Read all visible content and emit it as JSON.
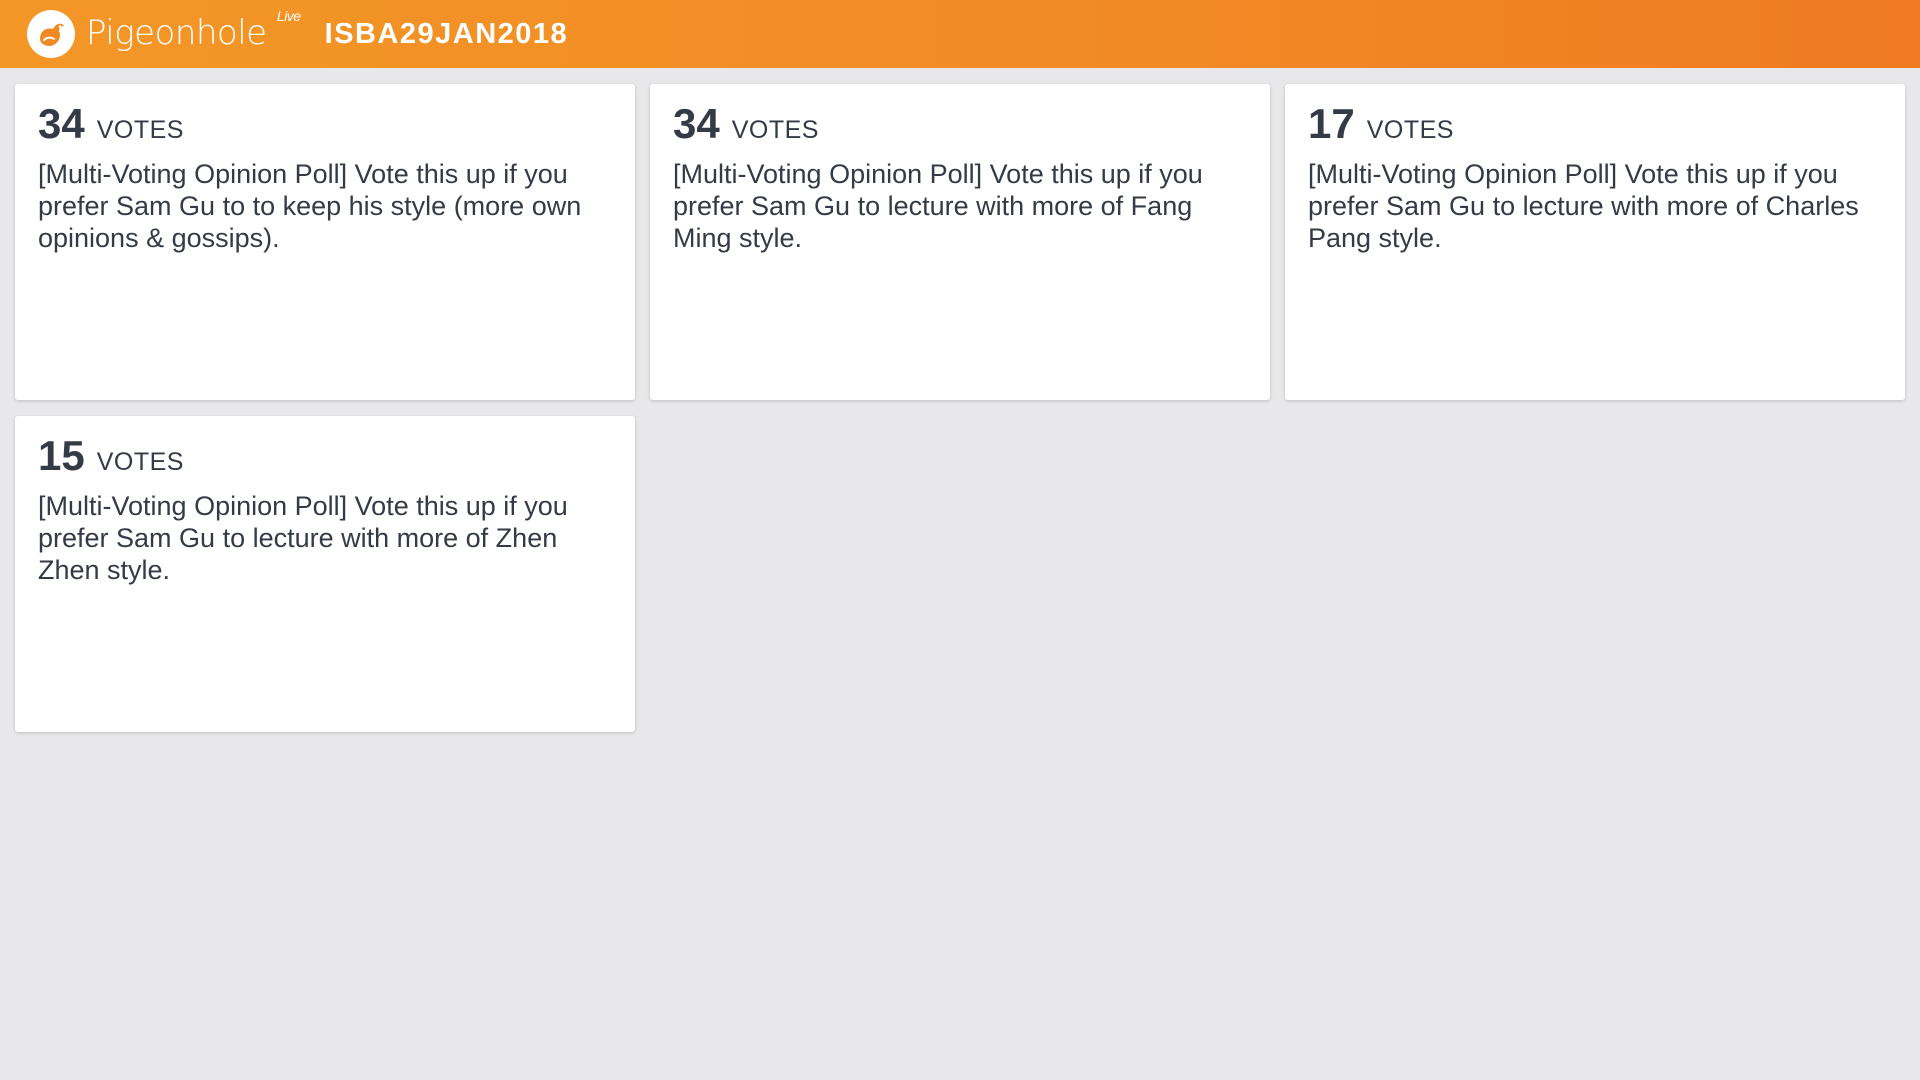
{
  "header": {
    "brand_name": "Pigeonhole",
    "brand_suffix": "Live",
    "session_code": "ISBA29JAN2018",
    "colors": {
      "gradient_start": "#f39727",
      "gradient_end": "#ef7a22"
    },
    "logo_icon": "pigeon-logo-icon"
  },
  "questions": [
    {
      "votes": "34",
      "votes_label": "VOTES",
      "text": "[Multi-Voting Opinion Poll] Vote this up if you prefer Sam Gu to to keep his style (more own opinions & gossips)."
    },
    {
      "votes": "34",
      "votes_label": "VOTES",
      "text": "[Multi-Voting Opinion Poll] Vote this up if you prefer Sam Gu to lecture with more of Fang Ming style."
    },
    {
      "votes": "17",
      "votes_label": "VOTES",
      "text": "[Multi-Voting Opinion Poll] Vote this up if you prefer Sam Gu to lecture with more of Charles Pang style."
    },
    {
      "votes": "15",
      "votes_label": "VOTES",
      "text": "[Multi-Voting Opinion Poll] Vote this up if you prefer Sam Gu to lecture with more of Zhen Zhen style."
    }
  ]
}
